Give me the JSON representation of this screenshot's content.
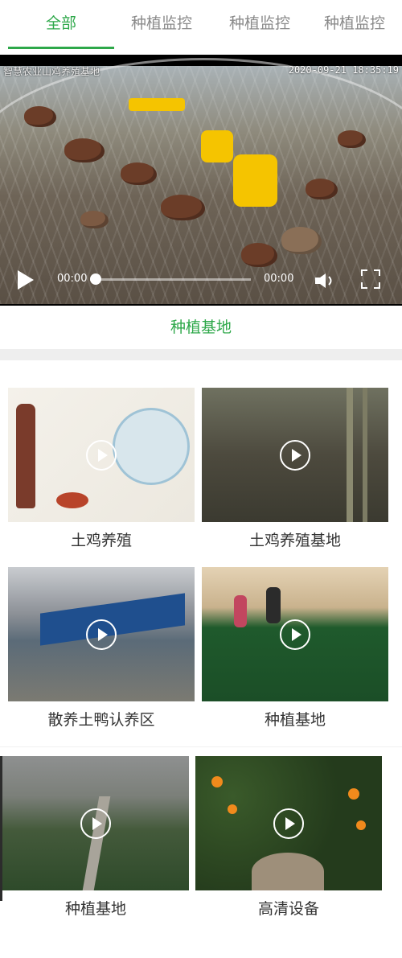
{
  "tabs": [
    "全部",
    "种植监控",
    "种植监控",
    "种植监控"
  ],
  "active_tab": "全部",
  "video": {
    "camera_title": "智慧农业山鸡养殖基地",
    "timestamp": "2020-09-21 18:35:19",
    "current_time": "00:00",
    "duration": "00:00",
    "progress": 0
  },
  "section_title": "种植基地",
  "items": [
    {
      "label": "土鸡养殖"
    },
    {
      "label": "土鸡养殖基地"
    },
    {
      "label": "散养土鸭认养区"
    },
    {
      "label": "种植基地"
    },
    {
      "label": "种植基地"
    },
    {
      "label": "高清设备"
    }
  ],
  "colors": {
    "accent": "#2ea84a",
    "tab_inactive": "#8a8a8a",
    "label": "#333333"
  }
}
